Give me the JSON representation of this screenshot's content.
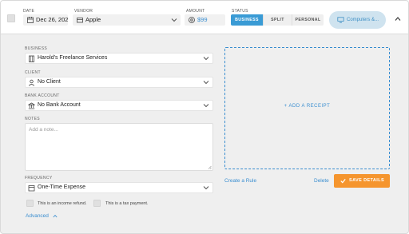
{
  "header": {
    "date": {
      "label": "DATE",
      "value": "Dec 26, 2023"
    },
    "vendor": {
      "label": "VENDOR",
      "value": "Apple"
    },
    "amount": {
      "label": "AMOUNT",
      "value": "$99"
    },
    "status": {
      "label": "STATUS",
      "options": [
        "BUSINESS",
        "SPLIT",
        "PERSONAL"
      ],
      "selected": "BUSINESS"
    },
    "category": "Computers &..."
  },
  "form": {
    "business": {
      "label": "BUSINESS",
      "value": "Harold's Freelance Services"
    },
    "client": {
      "label": "CLIENT",
      "value": "No Client"
    },
    "bank_account": {
      "label": "BANK ACCOUNT",
      "value": "No Bank Account"
    },
    "notes": {
      "label": "NOTES",
      "placeholder": "Add a note..."
    },
    "frequency": {
      "label": "FREQUENCY",
      "value": "One-Time Expense"
    },
    "income_refund_label": "This is an income refund.",
    "tax_payment_label": "This is a tax payment.",
    "advanced_label": "Advanced"
  },
  "receipt": {
    "label": "+ ADD A RECEIPT"
  },
  "actions": {
    "create_rule": "Create a Rule",
    "delete": "Delete",
    "save": "SAVE DETAILS"
  },
  "colors": {
    "accent": "#3a8ed0",
    "status_selected": "#3a9bd5",
    "save": "#f5952e",
    "category_pill_bg": "#cfe3ef"
  }
}
